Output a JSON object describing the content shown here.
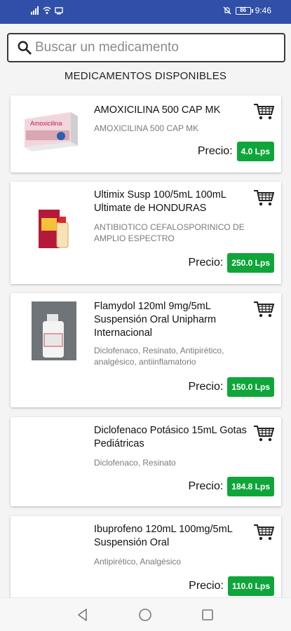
{
  "status_bar": {
    "time": "9:46",
    "battery": "86"
  },
  "search": {
    "placeholder": "Buscar un medicamento"
  },
  "section_title": "MEDICAMENTOS DISPONIBLES",
  "price_label": "Precio:",
  "products": [
    {
      "name": "AMOXICILINA 500 CAP MK",
      "description": "AMOXICILINA 500 CAP MK",
      "price": "4.0 Lps",
      "image_text": "Amoxicilina"
    },
    {
      "name": "Ultimix Susp 100/5mL  100mL Ultimate de HONDURAS",
      "description": "ANTIBIOTICO CEFALOSPORINICO DE AMPLIO ESPECTRO",
      "price": "250.0 Lps"
    },
    {
      "name": "Flamydol 120ml 9mg/5mL Suspensión Oral Unipharm Internacional",
      "description": "Diclofenaco, Resinato, Antipirético, analgésico, antiinflamatorio",
      "price": "150.0 Lps"
    },
    {
      "name": "Diclofenaco Potásico 15mL Gotas Pediátricas",
      "description": "Diclofenaco, Resinato",
      "price": "184.8 Lps"
    },
    {
      "name": "Ibuprofeno 120mL 100mg/5mL Suspensión Oral",
      "description": "Antipirético, Analgésico",
      "price": "110.0 Lps"
    }
  ],
  "icons": {
    "search": "search-icon",
    "cart": "cart-icon",
    "back": "back-icon",
    "home": "home-icon",
    "recents": "recents-icon"
  }
}
